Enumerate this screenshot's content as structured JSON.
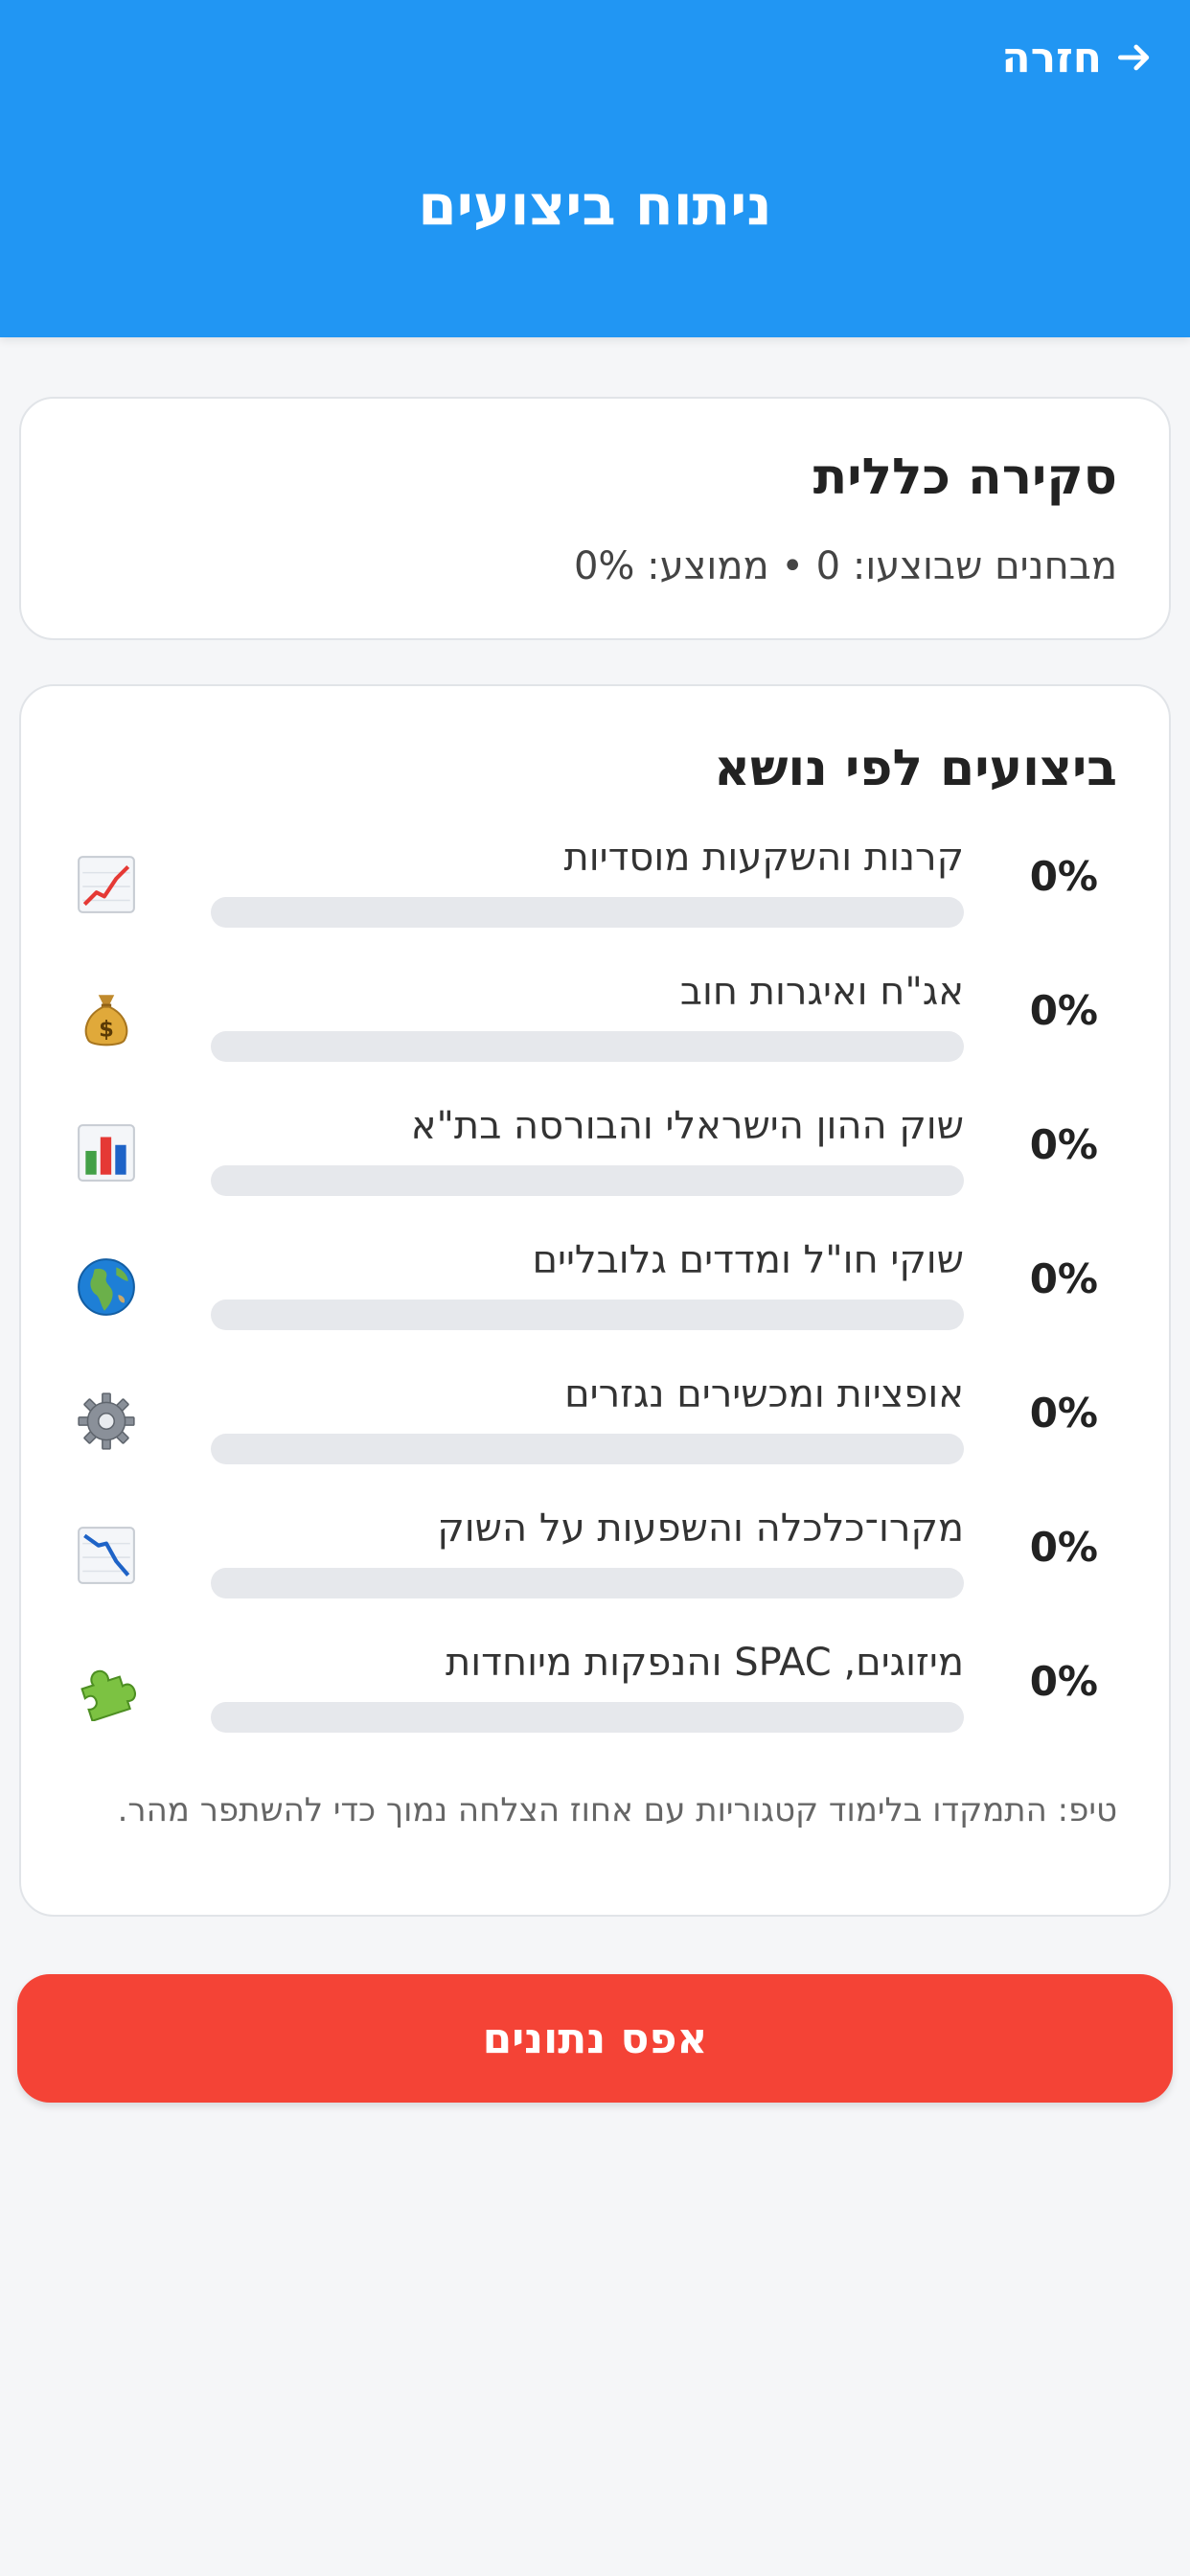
{
  "header": {
    "back_label": "חזרה",
    "title": "ניתוח ביצועים"
  },
  "overview": {
    "title": "סקירה כללית",
    "stats": "מבחנים שבוצעו: 0 • ממוצע: 0%"
  },
  "topics": {
    "title": "ביצועים לפי נושא",
    "items": [
      {
        "label": "קרנות והשקעות מוסדיות",
        "percent_text": "0%",
        "progress": 0,
        "icon": "chart-up-icon"
      },
      {
        "label": "אג\"ח ואיגרות חוב",
        "percent_text": "0%",
        "progress": 0,
        "icon": "money-bag-icon"
      },
      {
        "label": "שוק ההון הישראלי והבורסה בת\"א",
        "percent_text": "0%",
        "progress": 0,
        "icon": "bar-chart-icon"
      },
      {
        "label": "שוקי חו\"ל ומדדים גלובליים",
        "percent_text": "0%",
        "progress": 0,
        "icon": "globe-icon"
      },
      {
        "label": "אופציות ומכשירים נגזרים",
        "percent_text": "0%",
        "progress": 0,
        "icon": "gear-icon"
      },
      {
        "label": "מקרו־כלכלה והשפעות על השוק",
        "percent_text": "0%",
        "progress": 0,
        "icon": "chart-down-icon"
      },
      {
        "label": "מיזוגים, SPAC והנפקות מיוחדות",
        "percent_text": "0%",
        "progress": 0,
        "icon": "puzzle-icon"
      }
    ],
    "tip": "טיפ: התמקדו בלימוד קטגוריות עם אחוז הצלחה נמוך כדי להשתפר מהר."
  },
  "actions": {
    "reset_label": "אפס נתונים"
  },
  "colors": {
    "header": "#2196f3",
    "reset_button": "#f44336",
    "progress_track": "#e6e8ec"
  }
}
